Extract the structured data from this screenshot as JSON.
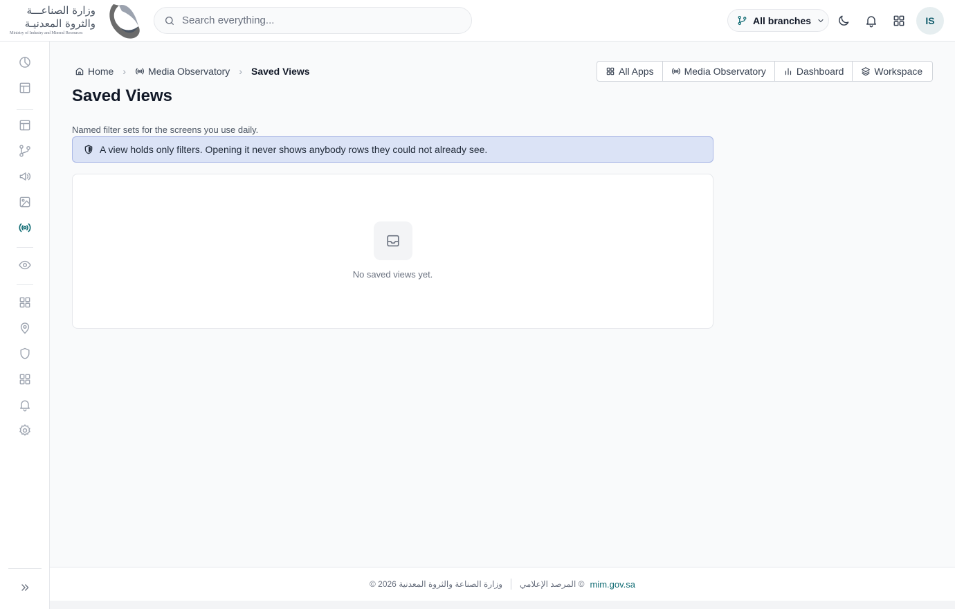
{
  "header": {
    "logo": {
      "arabic_line1": "وزارة الصناعـــة",
      "arabic_line2": "والثروة المعدنيـة",
      "english": "Ministry of Industry and Mineral Resources"
    },
    "search": {
      "placeholder": "Search everything..."
    },
    "branch_selector": {
      "label": "All branches"
    },
    "avatar_initials": "IS",
    "icons": [
      "moon-icon",
      "bell-icon",
      "apps-grid-icon"
    ]
  },
  "sidebar": {
    "items": [
      {
        "icon": "pie-chart-icon",
        "active": false
      },
      {
        "icon": "layout-icon",
        "active": false
      },
      {
        "icon": "layout-icon",
        "active": false
      },
      {
        "icon": "git-branch-icon",
        "active": false
      },
      {
        "icon": "megaphone-icon",
        "active": false
      },
      {
        "icon": "image-icon",
        "active": false
      },
      {
        "icon": "radio-broadcast-icon",
        "active": true
      },
      {
        "icon": "eye-icon",
        "active": false
      },
      {
        "icon": "grid-icon",
        "active": false
      },
      {
        "icon": "map-pin-icon",
        "active": false
      },
      {
        "icon": "shield-icon",
        "active": false
      },
      {
        "icon": "grid-icon",
        "active": false
      },
      {
        "icon": "bell-icon",
        "active": false
      },
      {
        "icon": "settings-icon",
        "active": false
      }
    ],
    "expand_icon": "chevrons-right-icon",
    "active_color": "#0f6b73"
  },
  "breadcrumb": {
    "home": "Home",
    "section": "Media Observatory",
    "current": "Saved Views"
  },
  "top_tabs": [
    {
      "label": "All Apps",
      "icon": "grid-icon"
    },
    {
      "label": "Media Observatory",
      "icon": "radio-broadcast-icon"
    },
    {
      "label": "Dashboard",
      "icon": "bar-chart-icon"
    },
    {
      "label": "Workspace",
      "icon": "layers-icon"
    }
  ],
  "page": {
    "title": "Saved Views",
    "description": "Named filter sets for the screens you use daily.",
    "info_banner": "A view holds only filters. Opening it never shows anybody rows they could not already see.",
    "empty_state": "No saved views yet."
  },
  "footer": {
    "left": "© 2026 وزارة الصناعة والثروة المعدنية",
    "middle": "المرصد الإعلامي ©",
    "link": "mim.gov.sa"
  }
}
